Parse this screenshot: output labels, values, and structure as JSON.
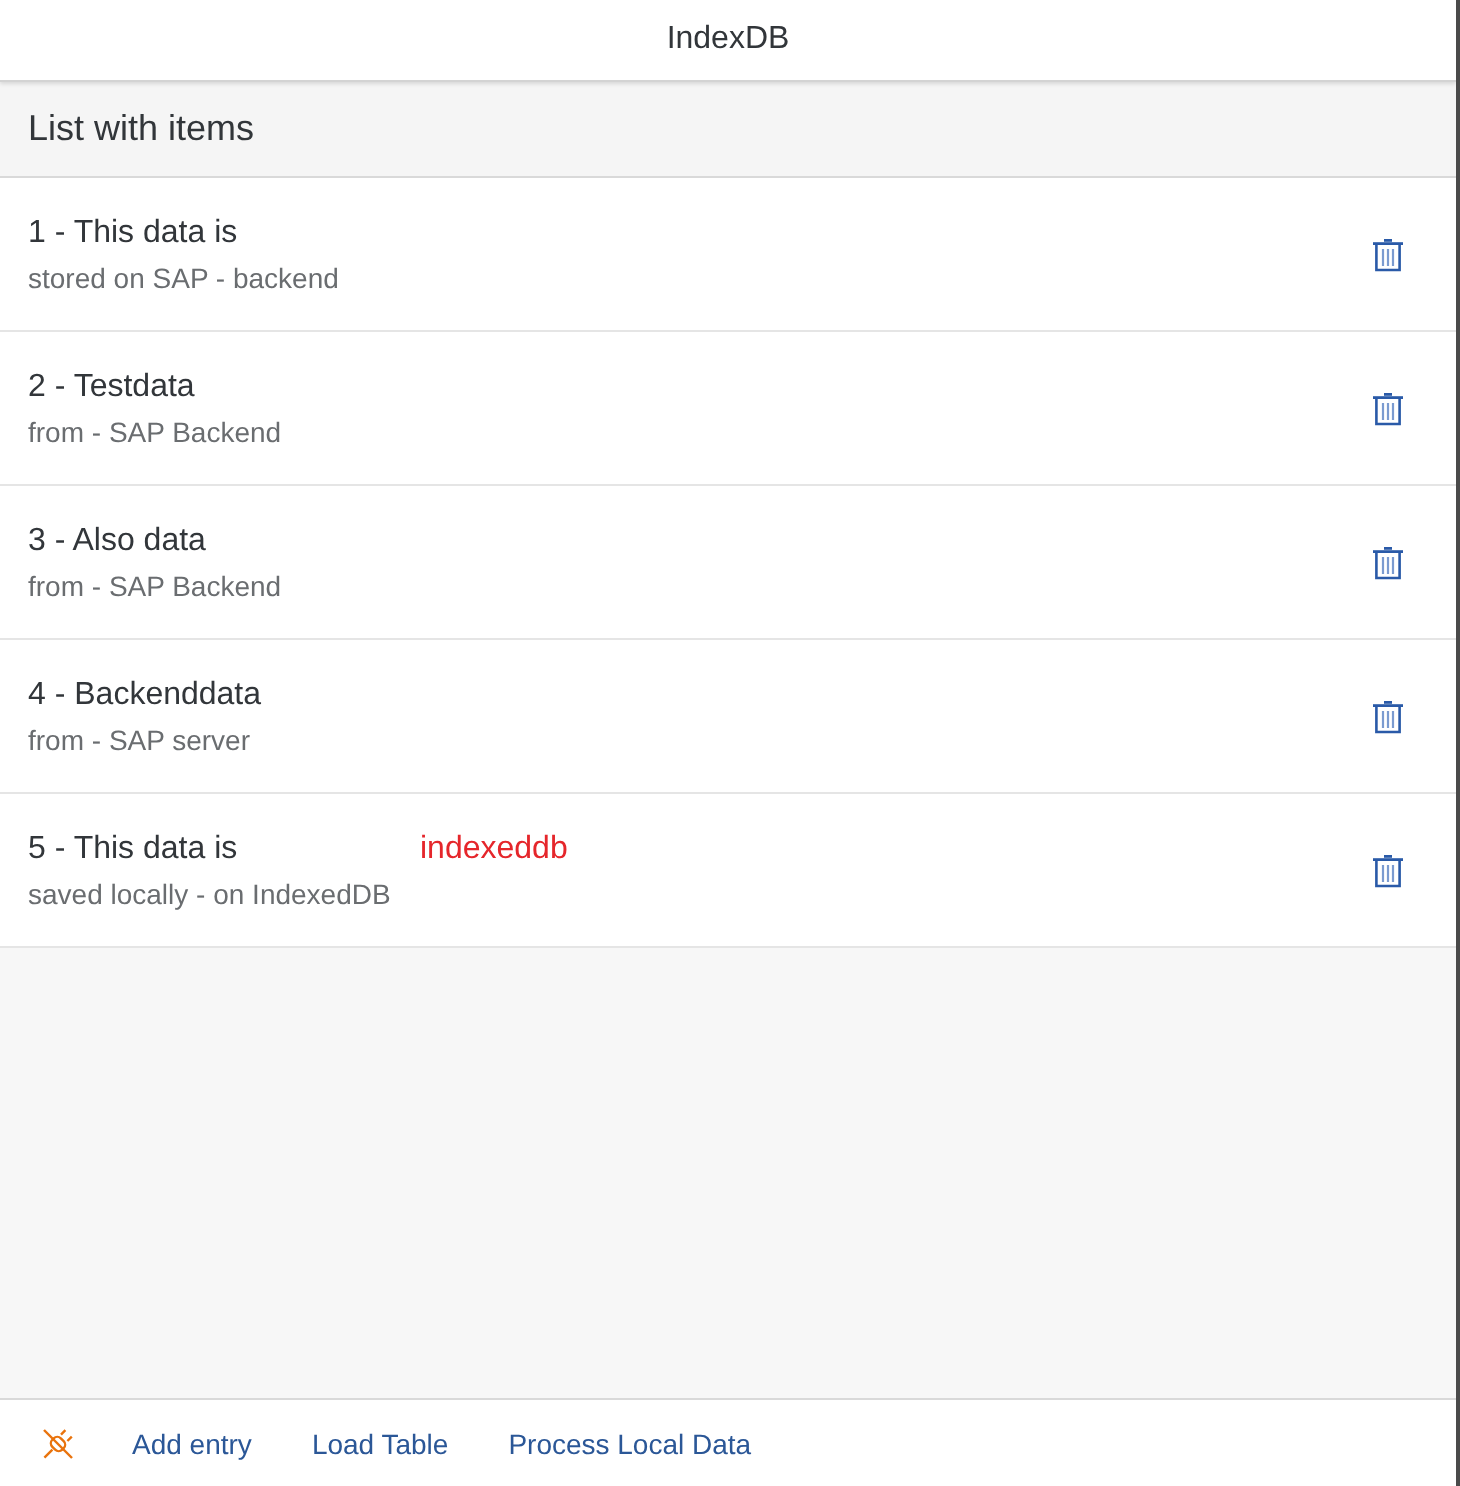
{
  "header": {
    "title": "IndexDB"
  },
  "list": {
    "title": "List with items",
    "items": [
      {
        "title": "1 - This data is",
        "description": "stored on SAP - backend"
      },
      {
        "title": "2 - Testdata",
        "description": "from - SAP Backend"
      },
      {
        "title": "3 - Also data",
        "description": "from - SAP Backend"
      },
      {
        "title": "4 - Backenddata",
        "description": "from - SAP server"
      },
      {
        "title": "5 - This data is",
        "description": "saved locally - on IndexedDB",
        "info": "indexeddb"
      }
    ]
  },
  "footer": {
    "buttons": [
      "Add entry",
      "Load Table",
      "Process Local Data"
    ]
  }
}
